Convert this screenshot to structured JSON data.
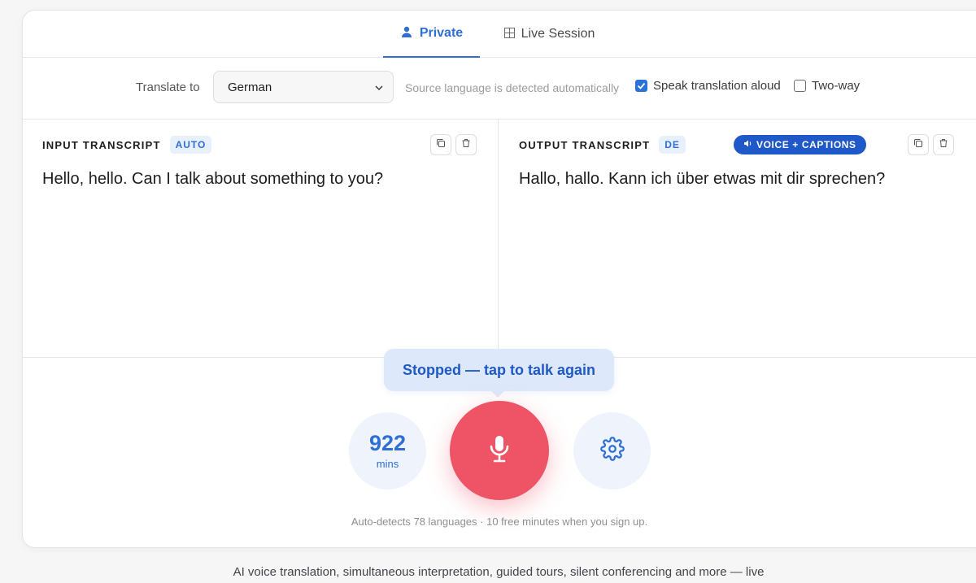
{
  "tabs": {
    "private": {
      "label": "Private",
      "icon": "user-icon",
      "active": true
    },
    "live": {
      "label": "Live Session",
      "icon": "grid-icon",
      "active": false
    }
  },
  "controls": {
    "translate_label": "Translate to",
    "language_selected": "German",
    "detect_hint": "Source language is detected automatically",
    "speak_label": "Speak translation aloud",
    "speak_checked": true,
    "twoway_label": "Two-way",
    "twoway_checked": false
  },
  "input": {
    "title": "INPUT TRANSCRIPT",
    "badge": "AUTO",
    "text": "Hello, hello. Can I talk about something to you?"
  },
  "output": {
    "title": "OUTPUT TRANSCRIPT",
    "badge": "DE",
    "voice_pill": "VOICE + CAPTIONS",
    "voice_pill_icon": "speaker-icon",
    "text": "Hallo, hallo. Kann ich über etwas mit dir sprechen?"
  },
  "status": {
    "bubble": "Stopped — tap to talk again",
    "minutes_value": "922",
    "minutes_unit": "mins",
    "mic_icon": "microphone-icon",
    "settings_icon": "gear-icon",
    "footnote": "Auto-detects 78 languages · 10 free minutes when you sign up."
  },
  "tagline": "AI voice translation, simultaneous interpretation, guided tours, silent conferencing and more — live",
  "colors": {
    "accent": "#2f6fd3",
    "pill": "#1f58c8",
    "mic": "#ef5466",
    "badge_bg": "#e8f0fc",
    "bubble_bg": "#dde9fb"
  }
}
